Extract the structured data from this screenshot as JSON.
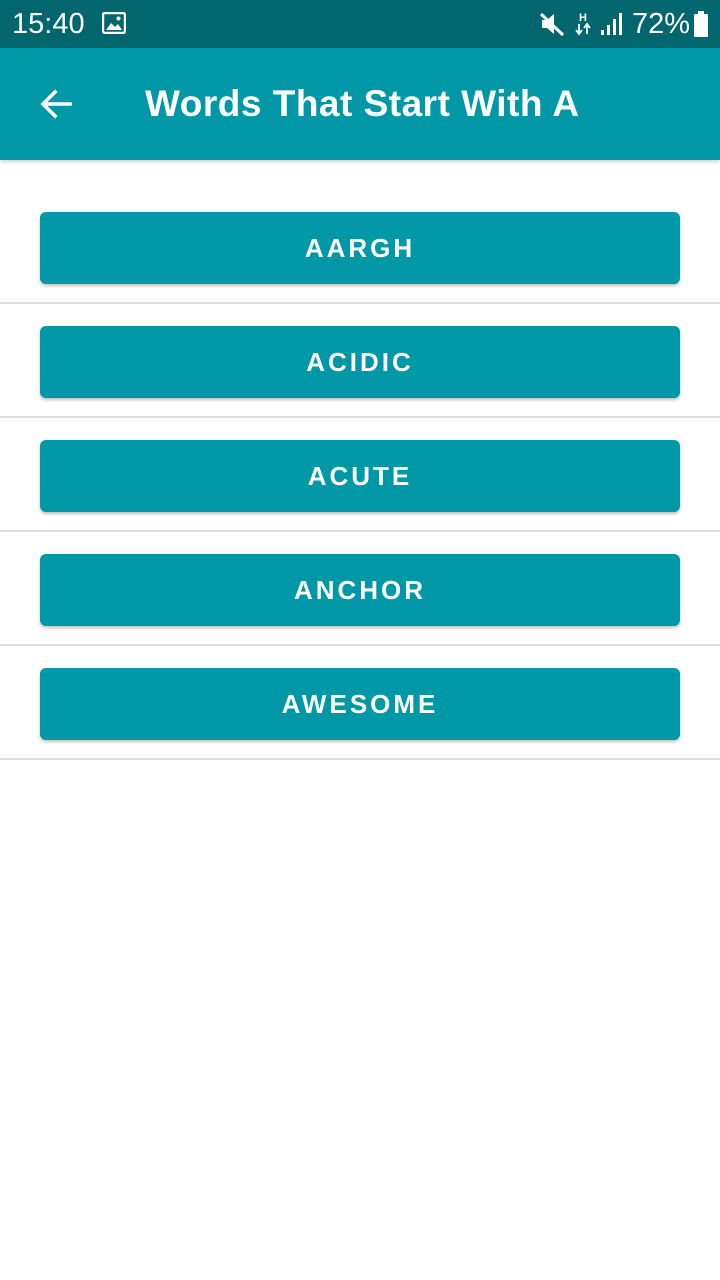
{
  "status_bar": {
    "time": "15:40",
    "battery": "72%",
    "network_type": "H",
    "icons": [
      "gallery-icon",
      "mute-icon",
      "network-icon",
      "signal-icon",
      "battery-icon"
    ]
  },
  "app_bar": {
    "back_icon": "arrow-back-icon",
    "title": "Words That Start With A"
  },
  "words": [
    "AARGH",
    "ACIDIC",
    "ACUTE",
    "ANCHOR",
    "AWESOME"
  ],
  "colors": {
    "status_bar": "#02666f",
    "primary": "#0097a7",
    "divider": "#dddddd",
    "background": "#ffffff",
    "text_on_primary": "#ffffff"
  }
}
